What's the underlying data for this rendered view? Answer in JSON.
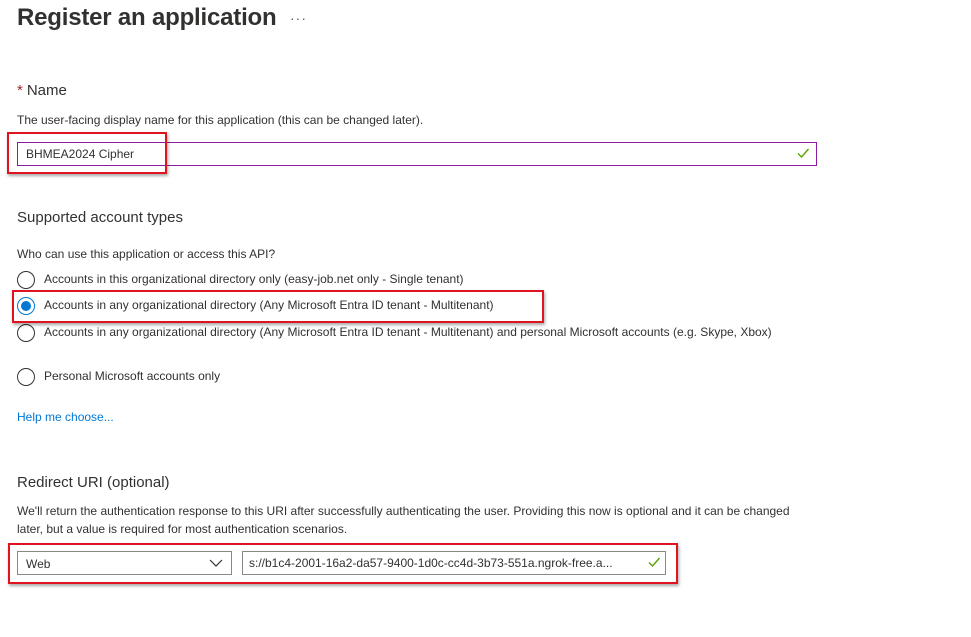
{
  "page": {
    "title": "Register an application",
    "more_label": "···"
  },
  "name_section": {
    "required_mark": "*",
    "label": "Name",
    "description": "The user-facing display name for this application (this can be changed later).",
    "value": "BHMEA2024 Cipher",
    "valid_icon": "checkmark-icon"
  },
  "account_types": {
    "heading": "Supported account types",
    "question": "Who can use this application or access this API?",
    "options": [
      {
        "label": "Accounts in this organizational directory only (easy-job.net only - Single tenant)",
        "selected": false
      },
      {
        "label": "Accounts in any organizational directory (Any Microsoft Entra ID tenant - Multitenant)",
        "selected": true
      },
      {
        "label": "Accounts in any organizational directory (Any Microsoft Entra ID tenant - Multitenant) and personal Microsoft accounts (e.g. Skype, Xbox)",
        "selected": false
      },
      {
        "label": "Personal Microsoft accounts only",
        "selected": false
      }
    ],
    "help_link": "Help me choose..."
  },
  "redirect": {
    "heading": "Redirect URI (optional)",
    "description": "We'll return the authentication response to this URI after successfully authenticating the user. Providing this now is optional and it can be changed later, but a value is required for most authentication scenarios.",
    "platform_value": "Web",
    "uri_value": "s://b1c4-2001-16a2-da57-9400-1d0c-cc4d-3b73-551a.ngrok-free.a...",
    "valid_icon": "checkmark-icon"
  },
  "colors": {
    "accent": "#0078d4",
    "highlight": "#e0141e",
    "valid": "#57a300",
    "focus_border": "#8a1c9f"
  }
}
